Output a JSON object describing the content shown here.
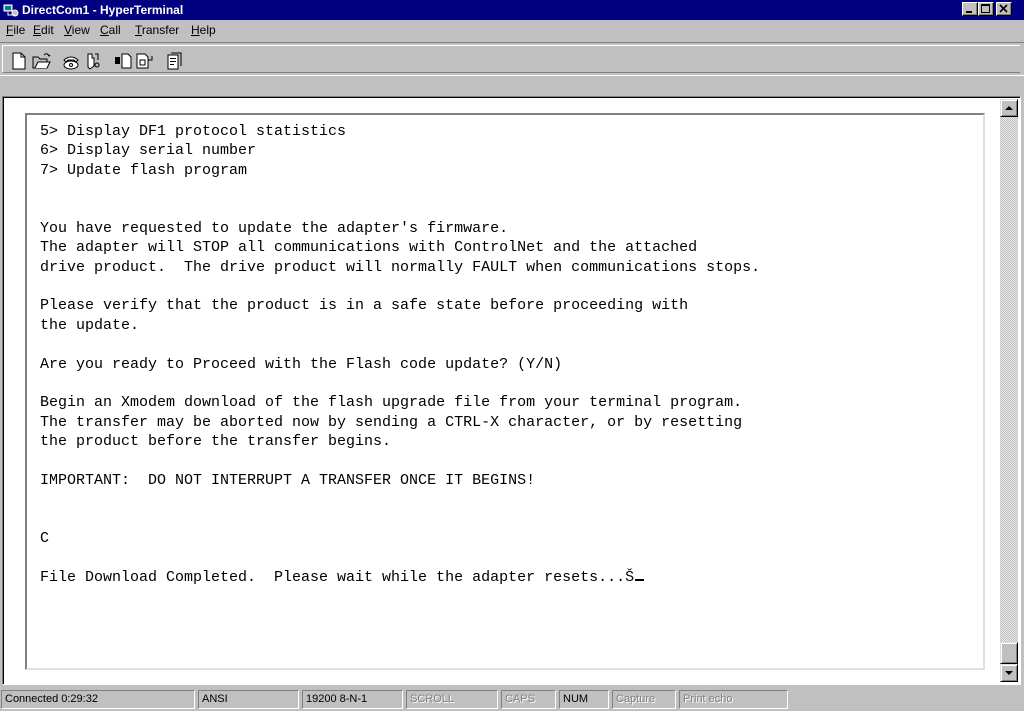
{
  "window": {
    "title": "DirectCom1 - HyperTerminal"
  },
  "menu": {
    "items": [
      "File",
      "Edit",
      "View",
      "Call",
      "Transfer",
      "Help"
    ]
  },
  "toolbar": {
    "buttons": [
      {
        "name": "new-connection",
        "icon": "new-document-icon"
      },
      {
        "name": "open",
        "icon": "open-folder-icon"
      },
      {
        "name": "connect",
        "icon": "phone-icon"
      },
      {
        "name": "disconnect",
        "icon": "hang-up-icon"
      },
      {
        "name": "send",
        "icon": "send-file-icon"
      },
      {
        "name": "receive",
        "icon": "receive-file-icon"
      },
      {
        "name": "properties",
        "icon": "properties-icon"
      }
    ]
  },
  "terminal": {
    "lines": [
      "5> Display DF1 protocol statistics",
      "6> Display serial number",
      "7> Update flash program",
      "",
      "",
      "You have requested to update the adapter's firmware.",
      "The adapter will STOP all communications with ControlNet and the attached",
      "drive product.  The drive product will normally FAULT when communications stops.",
      "",
      "Please verify that the product is in a safe state before proceeding with",
      "the update.",
      "",
      "Are you ready to Proceed with the Flash code update? (Y/N)",
      "",
      "Begin an Xmodem download of the flash upgrade file from your terminal program.",
      "The transfer may be aborted now by sending a CTRL-X character, or by resetting",
      "the product before the transfer begins.",
      "",
      "IMPORTANT:  DO NOT INTERRUPT A TRANSFER ONCE IT BEGINS!",
      "",
      "",
      "C",
      "",
      "File Download Completed.  Please wait while the adapter resets...Š"
    ]
  },
  "statusbar": {
    "connected": "Connected 0:29:32",
    "emulation": "ANSI",
    "settings": "19200 8-N-1",
    "scroll": "SCROLL",
    "caps": "CAPS",
    "num": "NUM",
    "capture": "Capture",
    "print_echo": "Print echo"
  },
  "colors": {
    "titlebar": "#000080",
    "face": "#c0c0c0",
    "terminal_bg": "#ffffff"
  }
}
